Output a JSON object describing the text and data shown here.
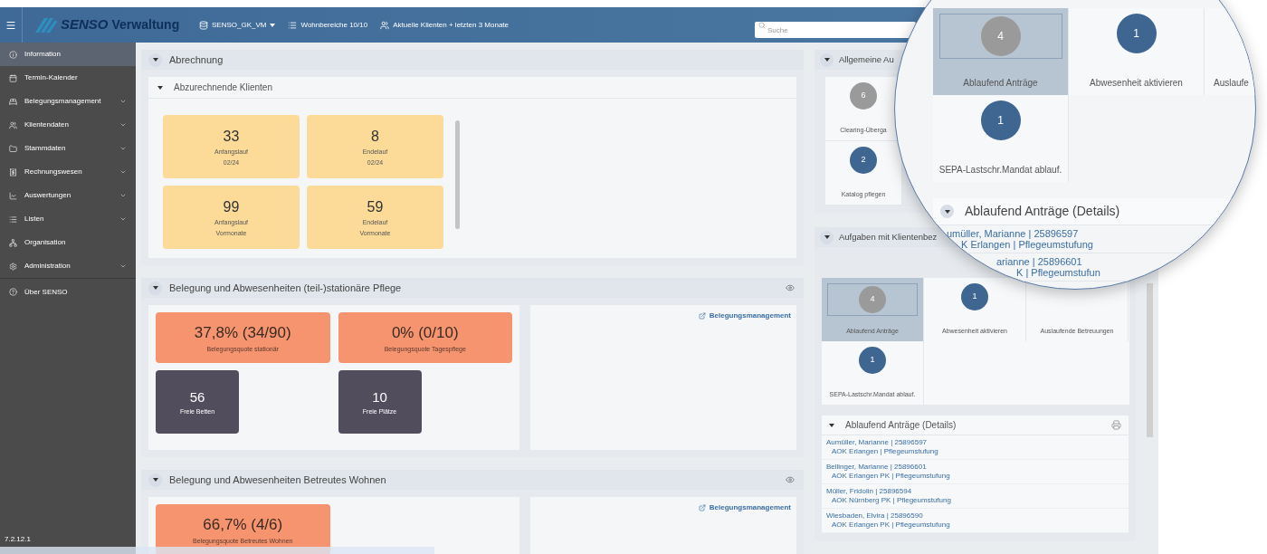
{
  "header": {
    "logo_title": "SENSO",
    "logo_subtitle": "Verwaltung",
    "database": "SENSO_GK_VM",
    "units": "Wohnbereiche 10/10",
    "clients_filter": "Aktuelle Klienten + letzten 3 Monate",
    "search": {
      "placeholder": "Suche"
    }
  },
  "sidebar": {
    "items": [
      {
        "label": "Information",
        "selected": true,
        "expandable": false
      },
      {
        "label": "Termin-Kalender",
        "selected": false,
        "expandable": false
      },
      {
        "label": "Belegungsmanagement",
        "selected": false,
        "expandable": true
      },
      {
        "label": "Klientendaten",
        "selected": false,
        "expandable": true
      },
      {
        "label": "Stammdaten",
        "selected": false,
        "expandable": true
      },
      {
        "label": "Rechnungswesen",
        "selected": false,
        "expandable": true
      },
      {
        "label": "Auswertungen",
        "selected": false,
        "expandable": true
      },
      {
        "label": "Listen",
        "selected": false,
        "expandable": true
      },
      {
        "label": "Organisation",
        "selected": false,
        "expandable": false
      },
      {
        "label": "Administration",
        "selected": false,
        "expandable": true
      },
      {
        "label": "Über SENSO",
        "selected": false,
        "expandable": false
      }
    ],
    "version": "7.2.12.1"
  },
  "abrechnung": {
    "title": "Abrechnung",
    "sub_title": "Abzurechnende Klienten",
    "tiles": [
      {
        "value": "33",
        "label": "Anfangslauf",
        "period": "02/24"
      },
      {
        "value": "8",
        "label": "Endelauf",
        "period": "02/24"
      },
      {
        "value": "99",
        "label": "Anfangslauf",
        "period": "Vormonate"
      },
      {
        "value": "59",
        "label": "Endelauf",
        "period": "Vormonate"
      }
    ]
  },
  "stationaer": {
    "title": "Belegung und Abwesenheiten (teil-)stationäre Pflege",
    "link": "Belegungsmanagement",
    "tiles": [
      {
        "kind": "rate",
        "value": "37,8% (34/90)",
        "label": "Belegungsquote stationär"
      },
      {
        "kind": "rate",
        "value": "0% (0/10)",
        "label": "Belegungsquote Tagespflege"
      },
      {
        "kind": "count",
        "value": "56",
        "label": "Freie Betten"
      },
      {
        "kind": "count",
        "value": "10",
        "label": "Freie Plätze"
      }
    ]
  },
  "betreutes": {
    "title": "Belegung und Abwesenheiten Betreutes Wohnen",
    "link": "Belegungsmanagement",
    "tiles": [
      {
        "kind": "rate",
        "value": "66,7% (4/6)",
        "label": "Belegungsquote Betreutes Wohnen"
      }
    ]
  },
  "allgemeine": {
    "title": "Allgemeine Au",
    "tasks": [
      {
        "count": "6",
        "label": "Clearing-Überga",
        "color": "#9a9a9a",
        "selected": false
      },
      {
        "count": "2",
        "label": "Katalog pflegen",
        "color": "#3e6690",
        "selected": false
      }
    ]
  },
  "klienten_aufgaben": {
    "title": "Aufgaben mit Klientenbez",
    "tasks": [
      {
        "count": "4",
        "label": "Ablaufend Anträge",
        "color": "#9a9a9a",
        "selected": true
      },
      {
        "count": "1",
        "label": "Abwesenheit aktivieren",
        "color": "#3e6690",
        "selected": false
      },
      {
        "label": "Auslaufende Betreuungen",
        "selected": false
      },
      {
        "count": "1",
        "label": "SEPA-Lastschr.Mandat ablauf.",
        "color": "#3e6690",
        "selected": false
      }
    ]
  },
  "details": {
    "title": "Ablaufend Anträge (Details)",
    "rows": [
      {
        "name": "Aumüller, Marianne | 25896597",
        "insurer": "AOK Erlangen | Pflegeumstufung"
      },
      {
        "name": "Bellinger, Marianne | 25896601",
        "insurer": "AOK Erlangen PK | Pflegeumstufung"
      },
      {
        "name": "Müller, Fridolin | 25896594",
        "insurer": "AOK Nürnberg PK | Pflegeumstufung"
      },
      {
        "name": "Wiesbaden, Elvira | 25896590",
        "insurer": "AOK Erlangen PK | Pflegeumstufung"
      }
    ]
  },
  "magnifier": {
    "tasks": [
      {
        "count": "4",
        "label": "Ablaufend Anträge",
        "color": "#9a9a9a",
        "selected": true
      },
      {
        "count": "1",
        "label": "Abwesenheit aktivieren",
        "color": "#3e6690",
        "selected": false
      },
      {
        "label": "Auslaufe",
        "selected": false
      },
      {
        "count": "1",
        "label": "SEPA-Lastschr.Mandat ablauf.",
        "color": "#3e6690",
        "selected": false
      }
    ],
    "details_title": "Ablaufend Anträge (Details)",
    "rows": [
      {
        "name": "umüller, Marianne | 25896597",
        "insurer": "K Erlangen | Pflegeumstufung"
      },
      {
        "name": "arianne | 25896601",
        "insurer": "K | Pflegeumstufun"
      }
    ]
  }
}
